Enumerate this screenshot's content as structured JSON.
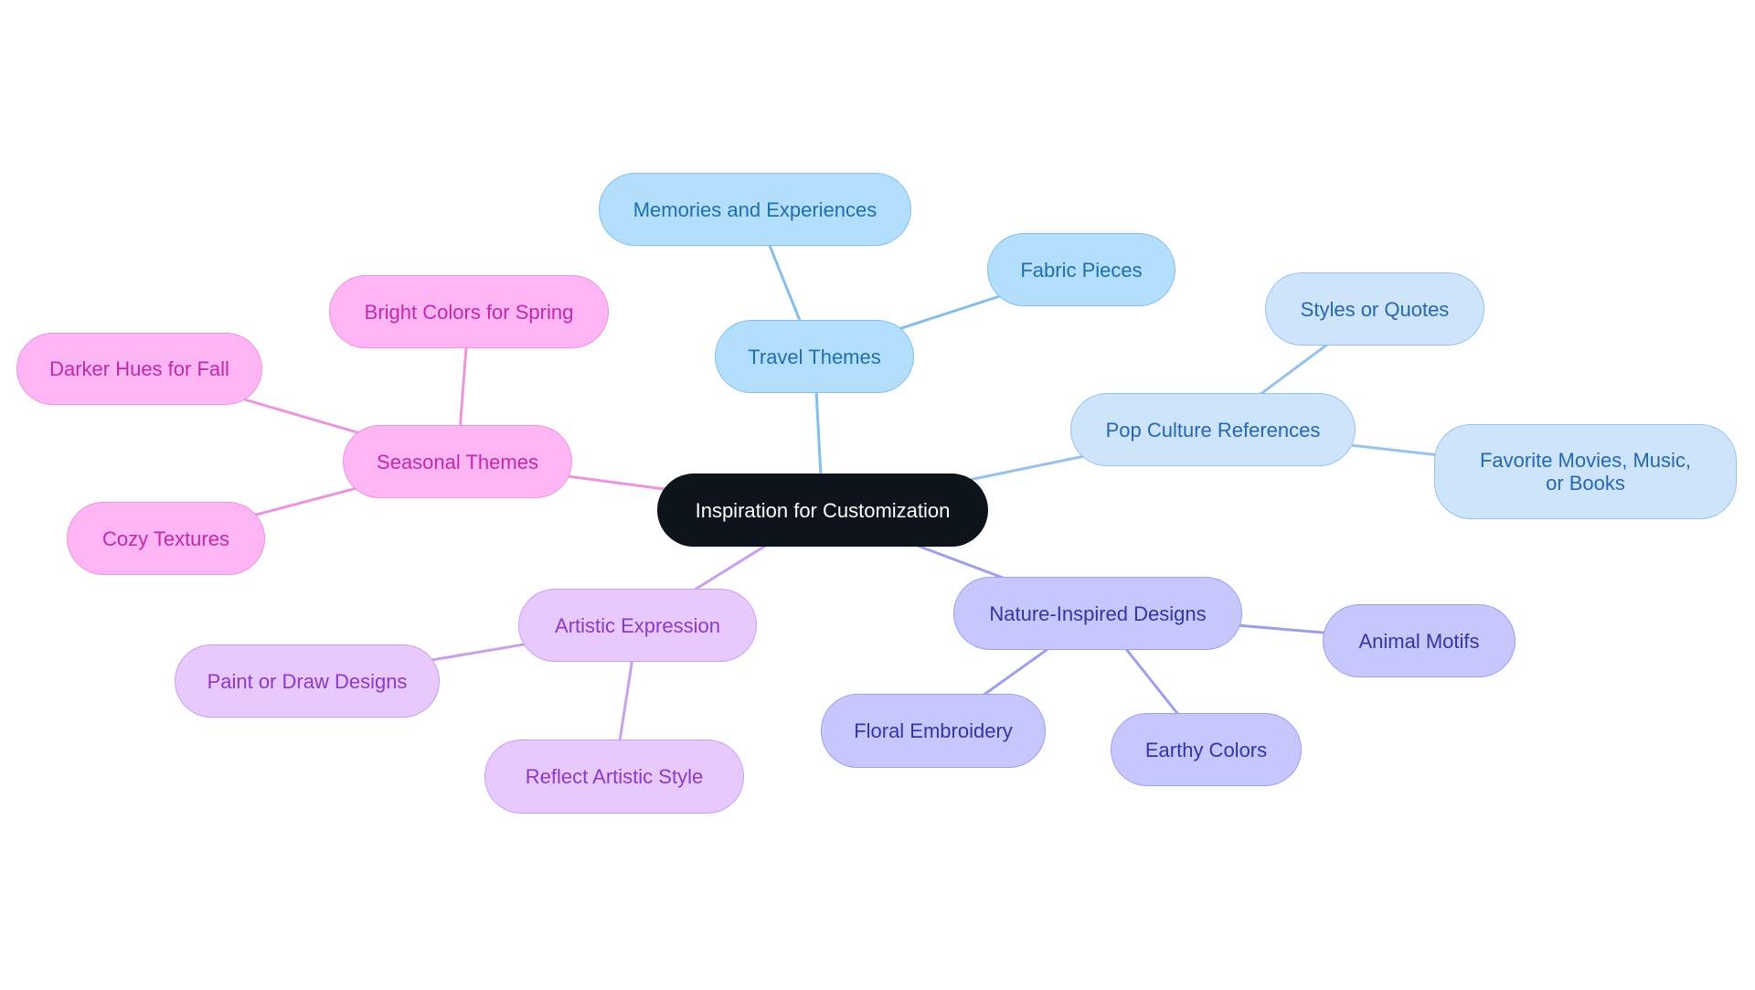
{
  "diagram": {
    "type": "mind-map",
    "root": {
      "id": "root",
      "label": "Inspiration for Customization"
    },
    "branches": [
      {
        "id": "travel",
        "label": "Travel Themes",
        "color": "#b3dffd",
        "edge_color": "#83bfea",
        "children": [
          {
            "id": "memories",
            "label": "Memories and Experiences"
          },
          {
            "id": "fabric",
            "label": "Fabric Pieces"
          }
        ]
      },
      {
        "id": "pop",
        "label": "Pop Culture References",
        "color": "#cde4fb",
        "edge_color": "#97c2ec",
        "children": [
          {
            "id": "styles",
            "label": "Styles or Quotes"
          },
          {
            "id": "favorites",
            "label": "Favorite Movies, Music, or Books"
          }
        ]
      },
      {
        "id": "nature",
        "label": "Nature-Inspired Designs",
        "color": "#c6c8fd",
        "edge_color": "#9c9fe9",
        "children": [
          {
            "id": "animal",
            "label": "Animal Motifs"
          },
          {
            "id": "earthy",
            "label": "Earthy Colors"
          },
          {
            "id": "floral",
            "label": "Floral Embroidery"
          }
        ]
      },
      {
        "id": "artistic",
        "label": "Artistic Expression",
        "color": "#e8c9fd",
        "edge_color": "#c9a0ec",
        "children": [
          {
            "id": "reflect",
            "label": "Reflect Artistic Style"
          },
          {
            "id": "paint",
            "label": "Paint or Draw Designs"
          }
        ]
      },
      {
        "id": "seasonal",
        "label": "Seasonal Themes",
        "color": "#fdb5f3",
        "edge_color": "#eb95df",
        "children": [
          {
            "id": "cozy",
            "label": "Cozy Textures"
          },
          {
            "id": "darker",
            "label": "Darker Hues for Fall"
          },
          {
            "id": "bright",
            "label": "Bright Colors for Spring"
          }
        ]
      }
    ]
  }
}
